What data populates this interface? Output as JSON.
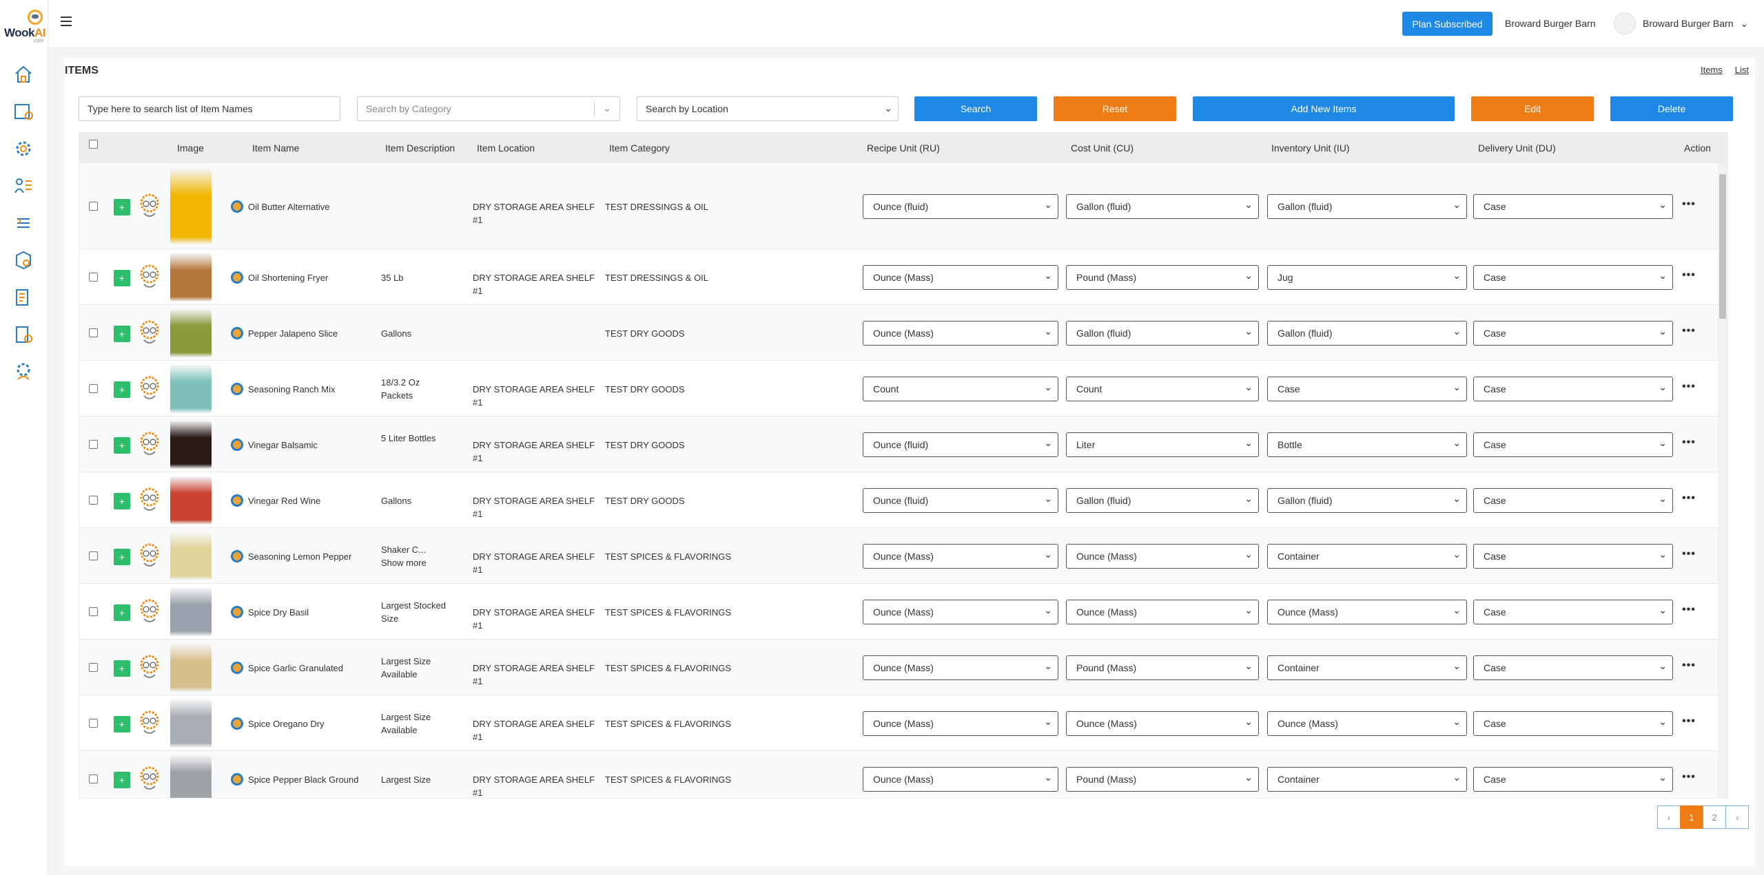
{
  "brand": {
    "name_main": "Wook",
    "name_accent": "AI",
    "sub": ".com"
  },
  "header": {
    "plan_button": "Plan Subscribed",
    "restaurant": "Broward Burger Barn",
    "user_name": "Broward Burger Barn",
    "user_chevron": "⌄"
  },
  "page": {
    "title": "ITEMS",
    "links": [
      "Items",
      "List"
    ]
  },
  "filters": {
    "search_placeholder": "Type here to search list of Item Names",
    "category_placeholder": "Search by Category",
    "location_placeholder": "Search by Location",
    "search": "Search",
    "reset": "Reset",
    "add": "Add New Items",
    "edit": "Edit",
    "delete": "Delete"
  },
  "table": {
    "headers": {
      "image": "Image",
      "name": "Item Name",
      "desc": "Item Description",
      "loc": "Item Location",
      "cat": "Item Category",
      "ru": "Recipe Unit (RU)",
      "cu": "Cost Unit (CU)",
      "iu": "Inventory Unit (IU)",
      "du": "Delivery Unit (DU)",
      "action": "Action"
    },
    "rows": [
      {
        "name": "Oil Butter Alternative",
        "desc": "",
        "loc": "DRY STORAGE AREA SHELF #1",
        "cat": "TEST DRESSINGS & OIL",
        "ru": "Ounce (fluid)",
        "cu": "Gallon (fluid)",
        "iu": "Gallon (fluid)",
        "du": "Case",
        "img": "#f2b705"
      },
      {
        "name": "Oil Shortening Fryer",
        "desc": "35 Lb",
        "loc": "DRY STORAGE AREA SHELF #1",
        "cat": "TEST DRESSINGS & OIL",
        "ru": "Ounce (Mass)",
        "cu": "Pound (Mass)",
        "iu": "Jug",
        "du": "Case",
        "img": "#b5763a"
      },
      {
        "name": "Pepper Jalapeno Slice",
        "desc": "Gallons",
        "loc": "",
        "cat": "TEST DRY GOODS",
        "ru": "Ounce (Mass)",
        "cu": "Gallon (fluid)",
        "iu": "Gallon (fluid)",
        "du": "Case",
        "img": "#8a9a3b"
      },
      {
        "name": "Seasoning Ranch Mix",
        "desc": "18/3.2 Oz Packets",
        "loc": "DRY STORAGE AREA SHELF #1",
        "cat": "TEST DRY GOODS",
        "ru": "Count",
        "cu": "Count",
        "iu": "Case",
        "du": "Case",
        "img": "#7cc0b9"
      },
      {
        "name": "Vinegar Balsamic",
        "desc": "5 Liter Bottles",
        "loc": "DRY STORAGE AREA SHELF #1",
        "cat": "TEST DRY GOODS",
        "ru": "Ounce (fluid)",
        "cu": "Liter",
        "iu": "Bottle",
        "du": "Case",
        "img": "#2a1a16"
      },
      {
        "name": "Vinegar Red Wine",
        "desc": "Gallons",
        "loc": "DRY STORAGE AREA SHELF #1",
        "cat": "TEST DRY GOODS",
        "ru": "Ounce (fluid)",
        "cu": "Gallon (fluid)",
        "iu": "Gallon (fluid)",
        "du": "Case",
        "img": "#c9432f"
      },
      {
        "name": "Seasoning Lemon Pepper",
        "desc": "Shaker C... Show more",
        "loc": "DRY STORAGE AREA SHELF #1",
        "cat": "TEST SPICES & FLAVORINGS",
        "ru": "Ounce (Mass)",
        "cu": "Ounce (Mass)",
        "iu": "Container",
        "du": "Case",
        "img": "#e0d49a"
      },
      {
        "name": "Spice Dry Basil",
        "desc": "Largest Stocked Size",
        "loc": "DRY STORAGE AREA SHELF #1",
        "cat": "TEST SPICES & FLAVORINGS",
        "ru": "Ounce (Mass)",
        "cu": "Ounce (Mass)",
        "iu": "Ounce (Mass)",
        "du": "Case",
        "img": "#9aa2ad"
      },
      {
        "name": "Spice Garlic Granulated",
        "desc": "Largest Size Available",
        "loc": "DRY STORAGE AREA SHELF #1",
        "cat": "TEST SPICES & FLAVORINGS",
        "ru": "Ounce (Mass)",
        "cu": "Pound (Mass)",
        "iu": "Container",
        "du": "Case",
        "img": "#d8c08e"
      },
      {
        "name": "Spice Oregano Dry",
        "desc": "Largest Size Available",
        "loc": "DRY STORAGE AREA SHELF #1",
        "cat": "TEST SPICES & FLAVORINGS",
        "ru": "Ounce (Mass)",
        "cu": "Ounce (Mass)",
        "iu": "Ounce (Mass)",
        "du": "Case",
        "img": "#a9aeb4"
      },
      {
        "name": "Spice Pepper Black Ground",
        "desc": "Largest Size",
        "loc": "DRY STORAGE AREA SHELF #1",
        "cat": "TEST SPICES & FLAVORINGS",
        "ru": "Ounce (Mass)",
        "cu": "Pound (Mass)",
        "iu": "Container",
        "du": "Case",
        "img": "#9ea3a8"
      }
    ]
  },
  "pagination": {
    "prev": "‹",
    "pages": [
      "1",
      "2"
    ],
    "next": "›",
    "active": "1"
  }
}
